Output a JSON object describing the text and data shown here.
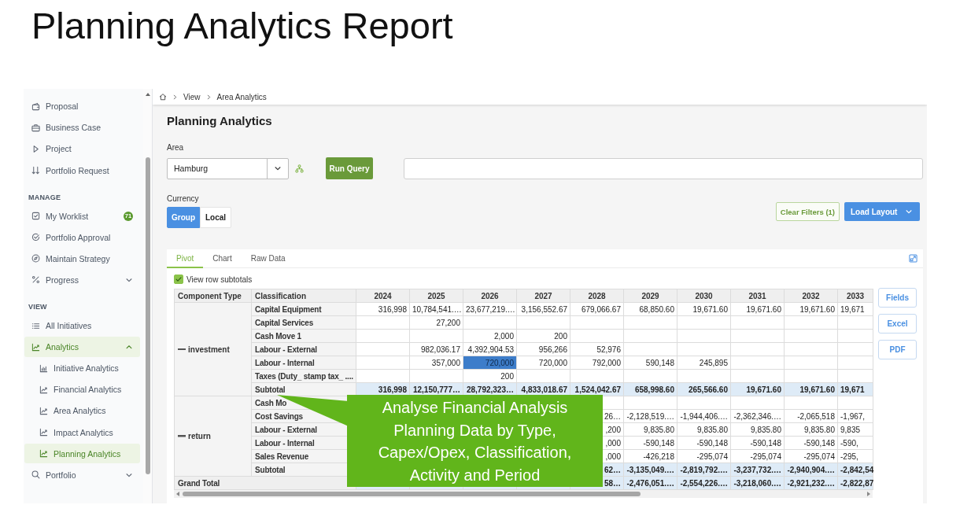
{
  "slide": {
    "title": "Planning Analytics Report"
  },
  "sidebar": {
    "sections": [
      {
        "items": [
          {
            "label": "Proposal",
            "selected": false
          },
          {
            "label": "Business Case",
            "selected": false
          },
          {
            "label": "Project",
            "selected": false
          },
          {
            "label": "Portfolio Request",
            "selected": false
          }
        ]
      },
      {
        "heading": "MANAGE",
        "items": [
          {
            "label": "My Worklist",
            "badge": "71",
            "selected": false
          },
          {
            "label": "Portfolio Approval",
            "selected": false
          },
          {
            "label": "Maintain Strategy",
            "selected": false
          },
          {
            "label": "Progress",
            "expanded": false,
            "selected": false
          }
        ]
      },
      {
        "heading": "VIEW",
        "items": [
          {
            "label": "All Initiatives",
            "selected": false
          },
          {
            "label": "Analytics",
            "expanded": true,
            "selected": true,
            "children": [
              {
                "label": "Initiative Analytics",
                "selected": false
              },
              {
                "label": "Financial Analytics",
                "selected": false
              },
              {
                "label": "Area Analytics",
                "selected": false
              },
              {
                "label": "Impact Analytics",
                "selected": false
              },
              {
                "label": "Planning Analytics",
                "selected": true
              }
            ]
          },
          {
            "label": "Portfolio",
            "expanded": false,
            "selected": false
          }
        ]
      }
    ]
  },
  "breadcrumb": [
    "View",
    "Area Analytics"
  ],
  "page": {
    "title": "Planning Analytics",
    "area": {
      "label": "Area",
      "value": "Hamburg"
    },
    "run_query_button": "Run Query",
    "currency": {
      "label": "Currency",
      "options": [
        {
          "label": "Group",
          "selected": true
        },
        {
          "label": "Local",
          "selected": false
        }
      ]
    },
    "clear_filters_button": "Clear Filters (1)",
    "load_layout_button": "Load Layout"
  },
  "pivot": {
    "tabs": [
      {
        "label": "Pivot",
        "selected": true
      },
      {
        "label": "Chart",
        "selected": false
      },
      {
        "label": "Raw Data",
        "selected": false
      }
    ],
    "row_subtotals": {
      "label": "View row subtotals",
      "checked": true
    },
    "table": {
      "columns": [
        "Component Type",
        "Classification",
        "2024",
        "2025",
        "2026",
        "2027",
        "2028",
        "2029",
        "2030",
        "2031",
        "2032",
        "2033"
      ],
      "groups": [
        {
          "label": "investment",
          "expanded": true,
          "rows": [
            {
              "label": "Capital Equipment",
              "kind": "detail",
              "cells": [
                {
                  "text": "316,998",
                  "selected": false
                },
                {
                  "text": "10,784,541.…",
                  "selected": false
                },
                {
                  "text": "23,677,219.…",
                  "selected": false
                },
                {
                  "text": "3,156,552.67",
                  "selected": false
                },
                {
                  "text": "679,066.67",
                  "selected": false
                },
                {
                  "text": "68,850.60",
                  "selected": false
                },
                {
                  "text": "19,671.60",
                  "selected": false
                },
                {
                  "text": "19,671.60",
                  "selected": false
                },
                {
                  "text": "19,671.60",
                  "selected": false
                },
                {
                  "text": "19,671",
                  "selected": false
                }
              ]
            },
            {
              "label": "Capital Services",
              "kind": "detail",
              "cells": [
                null,
                {
                  "text": "27,200",
                  "selected": false
                },
                null,
                null,
                null,
                null,
                null,
                null,
                null,
                null
              ]
            },
            {
              "label": "Cash Move 1",
              "kind": "detail",
              "cells": [
                null,
                null,
                {
                  "text": "2,000",
                  "selected": false
                },
                {
                  "text": "200",
                  "selected": false
                },
                null,
                null,
                null,
                null,
                null,
                null
              ]
            },
            {
              "label": "Labour - External",
              "kind": "detail",
              "cells": [
                null,
                {
                  "text": "982,036.17",
                  "selected": false
                },
                {
                  "text": "4,392,904.53",
                  "selected": false
                },
                {
                  "text": "956,266",
                  "selected": false
                },
                {
                  "text": "52,976",
                  "selected": false
                },
                null,
                null,
                null,
                null,
                null
              ]
            },
            {
              "label": "Labour - Internal",
              "kind": "detail",
              "cells": [
                null,
                {
                  "text": "357,000",
                  "selected": false
                },
                {
                  "text": "720,000",
                  "selected": true
                },
                {
                  "text": "720,000",
                  "selected": false
                },
                {
                  "text": "792,000",
                  "selected": false
                },
                {
                  "text": "590,148",
                  "selected": false
                },
                {
                  "text": "245,895",
                  "selected": false
                },
                null,
                null,
                null
              ]
            },
            {
              "label": "Taxes (Duty_ stamp tax_ ....",
              "kind": "detail",
              "cells": [
                null,
                null,
                {
                  "text": "200",
                  "selected": false
                },
                null,
                null,
                null,
                null,
                null,
                null,
                null
              ]
            },
            {
              "label": "Subtotal",
              "kind": "subtotal",
              "cells": [
                {
                  "text": "316,998",
                  "selected": false
                },
                {
                  "text": "12,150,777…",
                  "selected": false
                },
                {
                  "text": "28,792,323…",
                  "selected": false
                },
                {
                  "text": "4,833,018.67",
                  "selected": false
                },
                {
                  "text": "1,524,042.67",
                  "selected": false
                },
                {
                  "text": "658,998.60",
                  "selected": false
                },
                {
                  "text": "265,566.60",
                  "selected": false
                },
                {
                  "text": "19,671.60",
                  "selected": false
                },
                {
                  "text": "19,671.60",
                  "selected": false
                },
                {
                  "text": "19,671",
                  "selected": false
                }
              ]
            }
          ]
        },
        {
          "label": "return",
          "expanded": true,
          "rows": [
            {
              "label": "Cash Mo",
              "kind": "detail",
              "cells": [
                null,
                null,
                null,
                null,
                null,
                null,
                null,
                null,
                null,
                null
              ]
            },
            {
              "label": "Cost Savings",
              "kind": "detail",
              "cells": [
                null,
                null,
                null,
                null,
                {
                  "text": "26…",
                  "selected": false
                },
                {
                  "text": "-2,128,519.…",
                  "selected": false
                },
                {
                  "text": "-1,944,406.…",
                  "selected": false
                },
                {
                  "text": "-2,362,346.…",
                  "selected": false
                },
                {
                  "text": "-2,065,518",
                  "selected": false
                },
                {
                  "text": "-1,967,",
                  "selected": false
                }
              ]
            },
            {
              "label": "Labour - External",
              "kind": "detail",
              "cells": [
                null,
                null,
                null,
                null,
                {
                  "text": ",200",
                  "selected": false
                },
                {
                  "text": "9,835.80",
                  "selected": false
                },
                {
                  "text": "9,835.80",
                  "selected": false
                },
                {
                  "text": "9,835.80",
                  "selected": false
                },
                {
                  "text": "9,835.80",
                  "selected": false
                },
                {
                  "text": "9,835",
                  "selected": false
                }
              ]
            },
            {
              "label": "Labour - Internal",
              "kind": "detail",
              "cells": [
                null,
                null,
                null,
                null,
                {
                  "text": ",000",
                  "selected": false
                },
                {
                  "text": "-590,148",
                  "selected": false
                },
                {
                  "text": "-590,148",
                  "selected": false
                },
                {
                  "text": "-590,148",
                  "selected": false
                },
                {
                  "text": "-590,148",
                  "selected": false
                },
                {
                  "text": "-590,",
                  "selected": false
                }
              ]
            },
            {
              "label": "Sales Revenue",
              "kind": "detail",
              "cells": [
                null,
                null,
                null,
                null,
                {
                  "text": ",000",
                  "selected": false
                },
                {
                  "text": "-426,218",
                  "selected": false
                },
                {
                  "text": "-295,074",
                  "selected": false
                },
                {
                  "text": "-295,074",
                  "selected": false
                },
                {
                  "text": "-295,074",
                  "selected": false
                },
                {
                  "text": "-295,",
                  "selected": false
                }
              ]
            },
            {
              "label": "Subtotal",
              "kind": "subtotal",
              "cells": [
                null,
                null,
                null,
                null,
                {
                  "text": "62…",
                  "selected": false
                },
                {
                  "text": "-3,135,049.…",
                  "selected": false
                },
                {
                  "text": "-2,819,792.…",
                  "selected": false
                },
                {
                  "text": "-3,237,732.…",
                  "selected": false
                },
                {
                  "text": "-2,940,904.…",
                  "selected": false
                },
                {
                  "text": "-2,842,54",
                  "selected": false
                }
              ]
            }
          ]
        }
      ],
      "grand_total": {
        "label": "Grand Total",
        "cells": [
          null,
          null,
          null,
          null,
          {
            "text": "58…",
            "selected": false
          },
          {
            "text": "-2,476,051.…",
            "selected": false
          },
          {
            "text": "-2,554,226.…",
            "selected": false
          },
          {
            "text": "-3,218,060.…",
            "selected": false
          },
          {
            "text": "-2,921,232.…",
            "selected": false
          },
          {
            "text": "-2,822,87",
            "selected": false
          }
        ]
      }
    },
    "buttons": [
      "Fields",
      "Excel",
      "PDF"
    ]
  },
  "callout": {
    "text": "Analyse Financial Analysis Planning Data by Type, Capex/Opex, Classification, Activity and Period"
  }
}
